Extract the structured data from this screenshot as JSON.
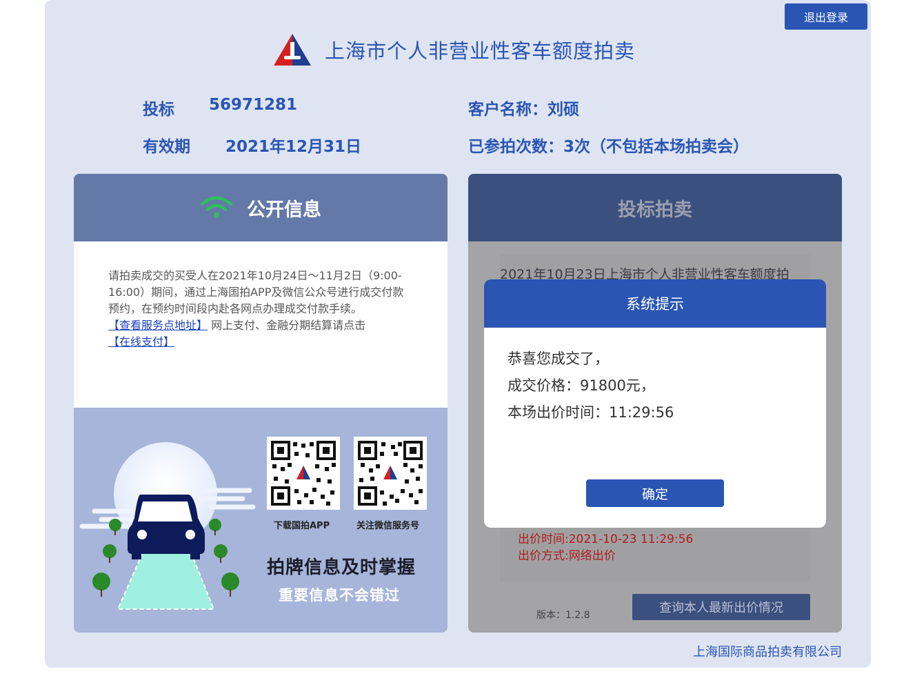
{
  "header": {
    "logout_label": "退出登录",
    "title": "上海市个人非营业性客车额度拍卖"
  },
  "info": {
    "bid_label": "投标",
    "bid_number": "56971281",
    "valid_label": "有效期",
    "valid_date": "2021年12月31日",
    "customer": "客户名称：刘硕",
    "participations": "已参拍次数：3次（不包括本场拍卖会）"
  },
  "left_panel": {
    "title": "公开信息",
    "notice_text": "请拍卖成交的买受人在2021年10月24日～11月2日（9:00-16:00）期间，通过上海国拍APP及微信公众号进行成交付款预约，在预约时间段内赴各网点办理成交付款手续。",
    "link_service": "【查看服务点地址】",
    "notice_mid": " 网上支付、金融分期结算请点击",
    "link_pay": "【在线支付】",
    "qr_app_label": "下载国拍APP",
    "qr_wechat_label": "关注微信服务号",
    "promo_main": "拍牌信息及时掌握",
    "promo_sub": "重要信息不会错过"
  },
  "right_panel": {
    "title": "投标拍卖",
    "lead_text": "2021年10月23日上海市个人非营业性客车额度拍",
    "bid_time": "出价时间:2021-10-23 11:29:56",
    "bid_method": "出价方式:网络出价",
    "version": "版本：1.2.8",
    "query_button": "查询本人最新出价情况"
  },
  "footer": {
    "company": "上海国际商品拍卖有限公司"
  },
  "modal": {
    "title": "系统提示",
    "line1": "恭喜您成交了，",
    "line2": "成交价格：91800元，",
    "line3": "本场出价时间：11:29:56",
    "ok_button": "确定"
  },
  "colors": {
    "brand_blue": "#2a55b3",
    "page_bg": "#dee4f2",
    "left_header": "#6579a8",
    "right_header": "#3b507f",
    "overlay_gray": "#a4a4a6",
    "alert_red": "#b01c1c"
  },
  "icons": [
    "auction-logo-icon",
    "wifi-signal-icon",
    "qr-code-icon",
    "car-illustration"
  ]
}
